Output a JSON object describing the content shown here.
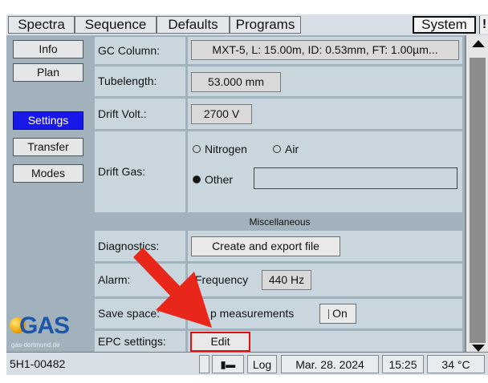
{
  "tabs": {
    "spectra": "Spectra",
    "sequence": "Sequence",
    "defaults": "Defaults",
    "programs": "Programs",
    "system": "System",
    "alert": "!"
  },
  "sidebar": {
    "items": [
      "Info",
      "Plan",
      "Settings",
      "Transfer",
      "Modes"
    ],
    "active": "Settings"
  },
  "logo": {
    "text": "GAS",
    "sub": "gas-dortmund.de"
  },
  "settings": {
    "gc_column": {
      "label": "GC Column:",
      "value": "MXT-5, L: 15.00m, ID: 0.53mm, FT: 1.00µm..."
    },
    "tubelength": {
      "label": "Tubelength:",
      "value": "53.000 mm"
    },
    "drift_volt": {
      "label": "Drift Volt.:",
      "value": "2700 V"
    },
    "drift_gas": {
      "label": "Drift Gas:",
      "options": [
        "Nitrogen",
        "Air",
        "Other"
      ],
      "selected": "Other",
      "other_value": ""
    },
    "misc_header": "Miscellaneous",
    "diagnostics": {
      "label": "Diagnostics:",
      "button": "Create and export file"
    },
    "alarm": {
      "label": "Alarm:",
      "frequency_label": "Frequency",
      "frequency_value": "440 Hz"
    },
    "save_space": {
      "label": "Save space:",
      "text": "p measurements",
      "toggle": "On"
    },
    "epc": {
      "label": "EPC settings:",
      "button": "Edit"
    }
  },
  "status": {
    "device": "5H1-00482",
    "log": "Log",
    "date": "Mar. 28. 2024",
    "time": "15:25",
    "temp": "34 °C"
  },
  "colors": {
    "active": "#1818e8",
    "panel": "#a2b2bc",
    "cell": "#c9d6dd",
    "highlight": "#e01010"
  }
}
